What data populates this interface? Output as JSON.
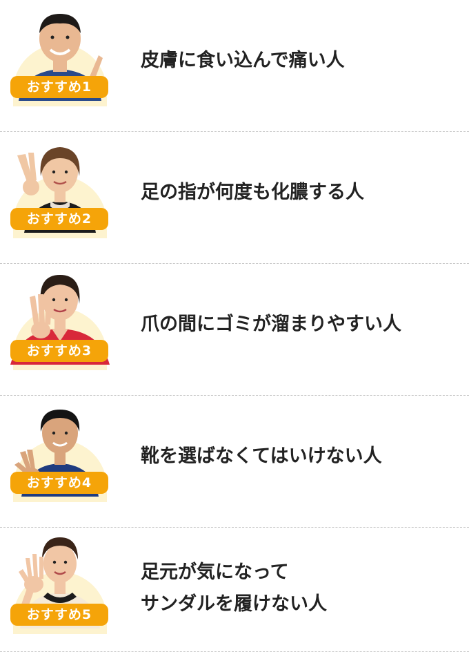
{
  "items": [
    {
      "badge": "おすすめ1",
      "lines": [
        "皮膚に食い込んで痛い人"
      ],
      "skin": "#e9b892",
      "shirt": "#2a4a8a",
      "hair": "#1e1a18"
    },
    {
      "badge": "おすすめ2",
      "lines": [
        "足の指が何度も化膿する人"
      ],
      "skin": "#f0c7a4",
      "shirt": "#1c1c1c",
      "hair": "#6a4428"
    },
    {
      "badge": "おすすめ3",
      "lines": [
        "爪の間にゴミが溜まりやすい人"
      ],
      "skin": "#f0c3a2",
      "shirt": "#d8283a",
      "hair": "#2a1d16"
    },
    {
      "badge": "おすすめ4",
      "lines": [
        "靴を選ばなくてはいけない人"
      ],
      "skin": "#d9a47c",
      "shirt": "#1f3c80",
      "hair": "#141414"
    },
    {
      "badge": "おすすめ5",
      "lines": [
        "足元が気になって",
        "サンダルを履けない人"
      ],
      "skin": "#f1c6a5",
      "shirt": "#f5ead8",
      "hair": "#3a2418"
    }
  ],
  "colors": {
    "badge": "#f5a409",
    "halo": "#fdf3cf",
    "divider": "#c8c8c8",
    "text": "#222222"
  }
}
